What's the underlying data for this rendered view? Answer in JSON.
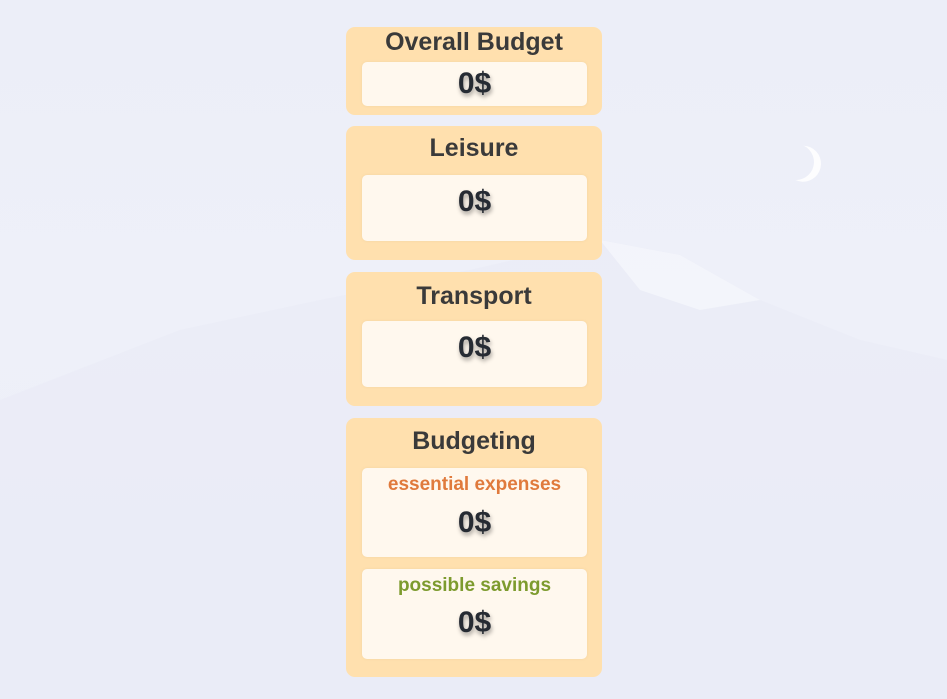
{
  "overall": {
    "title": "Overall Budget",
    "amount": "0$"
  },
  "leisure": {
    "title": "Leisure",
    "amount": "0$"
  },
  "transport": {
    "title": "Transport",
    "amount": "0$"
  },
  "budgeting": {
    "title": "Budgeting",
    "essential": {
      "label": "essential expenses",
      "amount": "0$",
      "color": "#e07a3c"
    },
    "savings": {
      "label": "possible savings",
      "amount": "0$",
      "color": "#7d9b2e"
    }
  },
  "colors": {
    "card_bg": "#ffe0ae",
    "inner_bg": "#fff8ee",
    "page_bg": "#eceef8"
  }
}
